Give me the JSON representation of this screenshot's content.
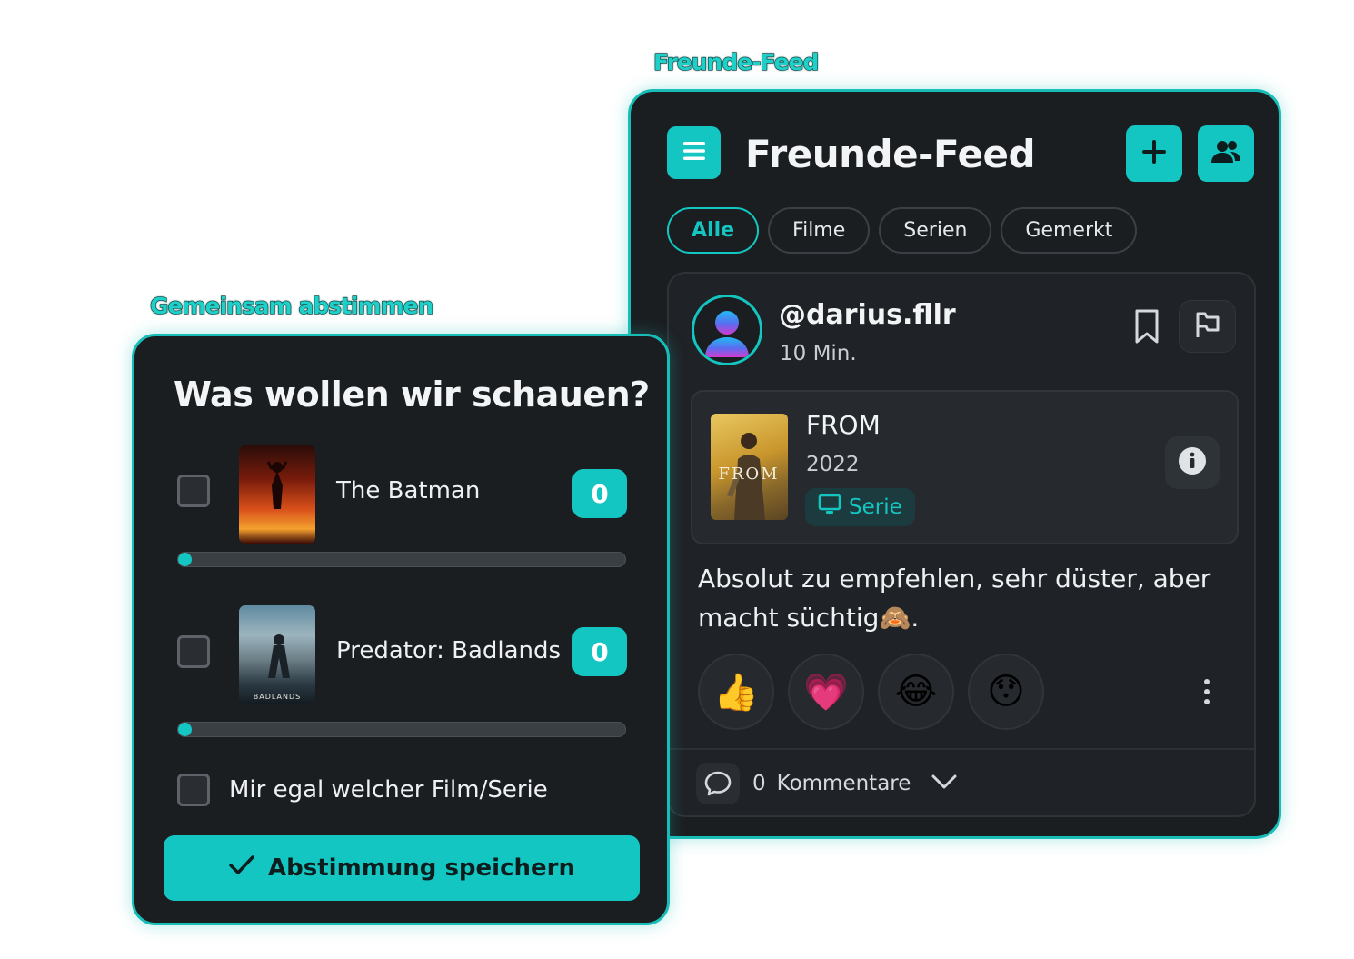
{
  "captions": {
    "feed": "Freunde-Feed",
    "vote": "Gemeinsam abstimmen"
  },
  "colors": {
    "accent": "#14c6c1",
    "panel_bg": "#1b1e21",
    "card_bg": "#1f2226"
  },
  "feed": {
    "title": "Freunde-Feed",
    "menu_icon": "menu-icon",
    "add_icon": "plus-icon",
    "friends_icon": "users-icon",
    "filters": [
      {
        "label": "Alle",
        "active": true
      },
      {
        "label": "Filme",
        "active": false
      },
      {
        "label": "Serien",
        "active": false
      },
      {
        "label": "Gemerkt",
        "active": false
      }
    ],
    "post": {
      "username": "@darius.fllr",
      "time": "10 Min.",
      "bookmark_icon": "bookmark-icon",
      "flag_icon": "flag-icon",
      "media": {
        "title": "FROM",
        "year": "2022",
        "poster_text": "FROM",
        "type_label": "Serie",
        "type_icon": "tv-icon",
        "info_icon": "info-icon"
      },
      "text": "Absolut zu empfehlen, sehr düster, aber macht süchtig🙈.",
      "reactions": [
        {
          "name": "thumbs-up",
          "emoji": "👍"
        },
        {
          "name": "heart",
          "emoji": "💗"
        },
        {
          "name": "laughing",
          "emoji": "😂"
        },
        {
          "name": "surprised",
          "emoji": "😯"
        }
      ],
      "comments": {
        "count": "0",
        "label": "Kommentare"
      }
    }
  },
  "vote": {
    "title": "Was wollen wir schauen?",
    "options": [
      {
        "label": "The Batman",
        "votes": "0",
        "progress": 0.03,
        "checked": false
      },
      {
        "label": "Predator: Badlands",
        "votes": "0",
        "progress": 0.03,
        "checked": false,
        "poster_text": "BADLANDS"
      }
    ],
    "no_preference": {
      "label": "Mir egal welcher Film/Serie",
      "checked": false
    },
    "save_label": "Abstimmung speichern"
  }
}
